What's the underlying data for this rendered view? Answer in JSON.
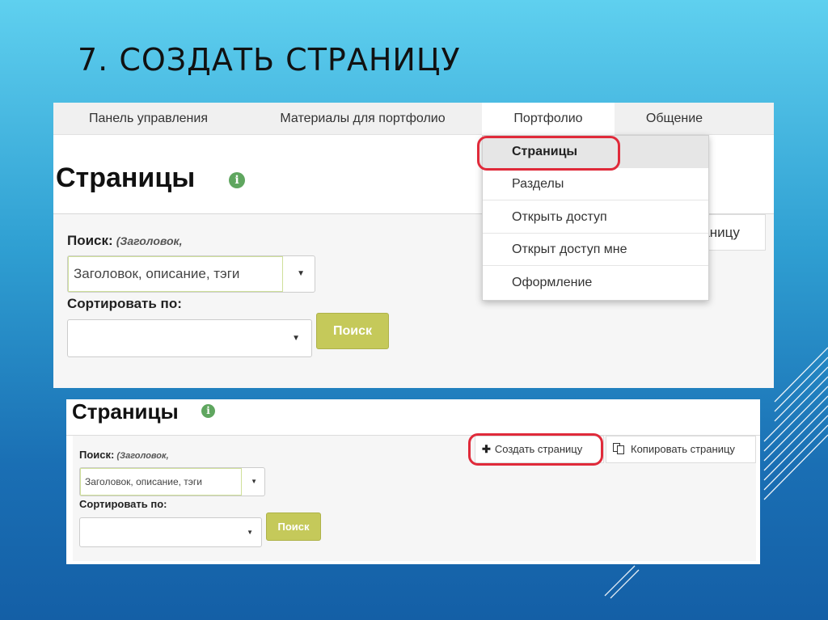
{
  "slide": {
    "title": "7. СОЗДАТЬ СТРАНИЦУ"
  },
  "colors": {
    "accent_green": "#c5c95a",
    "highlight_red": "#e02a3a",
    "info_green": "#5fa65f"
  },
  "navbar": {
    "items": [
      {
        "label": "Панель управления"
      },
      {
        "label": "Материалы для портфолио"
      },
      {
        "label": "Портфолио"
      },
      {
        "label": "Общение"
      }
    ],
    "active": "Портфолио"
  },
  "dropdown": {
    "items": [
      {
        "label": "Страницы"
      },
      {
        "label": "Разделы"
      },
      {
        "label": "Открыть доступ"
      },
      {
        "label": "Открыт доступ мне"
      },
      {
        "label": "Оформление"
      }
    ]
  },
  "panel1": {
    "title": "Страницы",
    "info_icon": "i",
    "search_label": "Поиск:",
    "search_hint": "(Заголовок,",
    "search_value": "Заголовок, описание, тэги",
    "sort_label": "Сортировать по:",
    "search_button": "Поиск",
    "create_button": "Создать страницу"
  },
  "panel2": {
    "title": "Страницы",
    "info_icon": "i",
    "search_label": "Поиск:",
    "search_hint": "(Заголовок,",
    "search_value": "Заголовок, описание, тэги",
    "sort_label": "Сортировать по:",
    "search_button": "Поиск",
    "create_button": "Создать страницу",
    "copy_button": "Копировать страницу"
  }
}
